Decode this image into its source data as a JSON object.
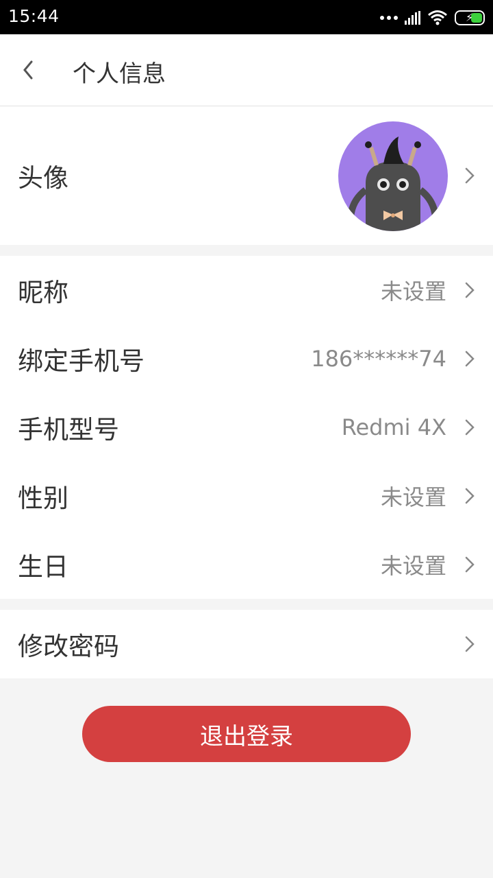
{
  "status_bar": {
    "time": "15:44"
  },
  "header": {
    "title": "个人信息"
  },
  "avatar_row": {
    "label": "头像"
  },
  "profile_rows": [
    {
      "label": "昵称",
      "value": "未设置"
    },
    {
      "label": "绑定手机号",
      "value": "186******74"
    },
    {
      "label": "手机型号",
      "value": "Redmi 4X"
    },
    {
      "label": "性别",
      "value": "未设置"
    },
    {
      "label": "生日",
      "value": "未设置"
    }
  ],
  "password_row": {
    "label": "修改密码"
  },
  "logout": {
    "label": "退出登录"
  },
  "colors": {
    "accent": "#d44040",
    "avatar_bg": "#a07de8",
    "background": "#f4f4f4"
  }
}
